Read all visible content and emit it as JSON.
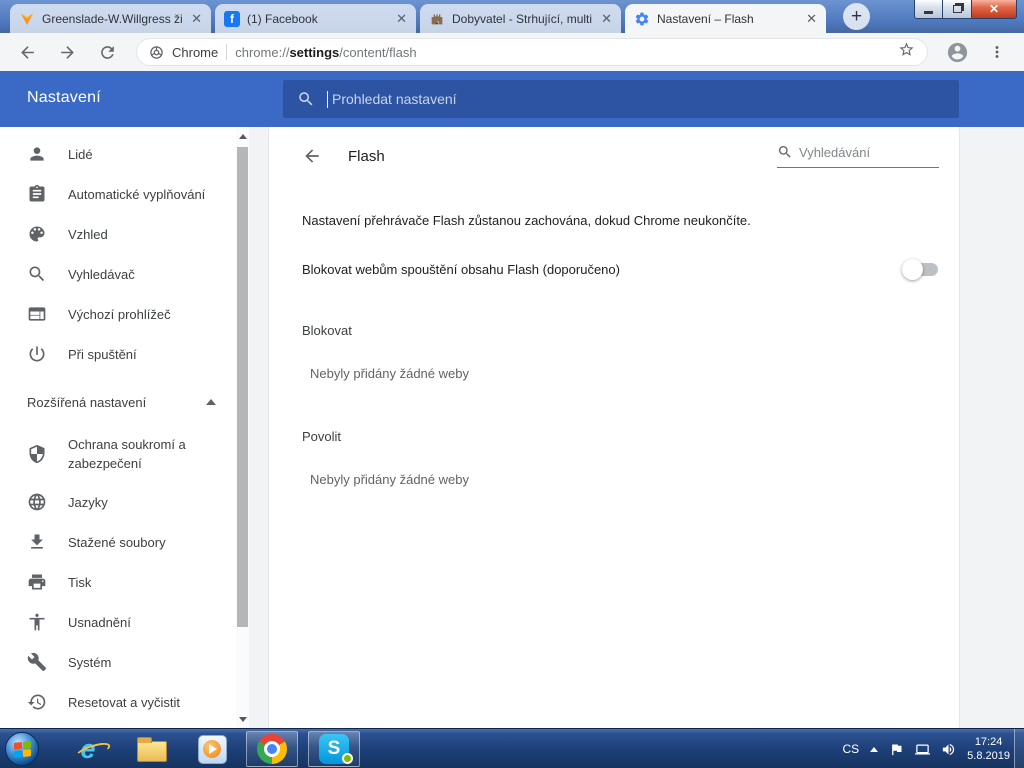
{
  "browser": {
    "tabs": [
      {
        "title": "Greenslade-W.Willgress ži",
        "icon": "v-logo",
        "active": false
      },
      {
        "title": "(1) Facebook",
        "icon": "facebook",
        "active": false
      },
      {
        "title": "Dobyvatel - Strhující, multi",
        "icon": "castle",
        "active": false
      },
      {
        "title": "Nastavení – Flash",
        "icon": "settings-gear",
        "active": true
      }
    ],
    "facebook_glyph": "f",
    "new_tab_glyph": "+",
    "close_glyph": "✕",
    "omnibox": {
      "badge": "Chrome",
      "scheme": "chrome://",
      "highlight": "settings",
      "path": "/content/flash"
    }
  },
  "settings_header": {
    "title": "Nastavení",
    "search_placeholder": "Prohledat nastavení"
  },
  "sidebar": {
    "items": [
      {
        "icon": "person",
        "label": "Lidé"
      },
      {
        "icon": "assignment",
        "label": "Automatické vyplňování"
      },
      {
        "icon": "palette",
        "label": "Vzhled"
      },
      {
        "icon": "search",
        "label": "Vyhledávač"
      },
      {
        "icon": "web",
        "label": "Výchozí prohlížeč"
      },
      {
        "icon": "power",
        "label": "Při spuštění"
      },
      {
        "icon": "security",
        "label": "Ochrana soukromí a zabezpečení"
      },
      {
        "icon": "language",
        "label": "Jazyky"
      },
      {
        "icon": "download",
        "label": "Stažené soubory"
      },
      {
        "icon": "print",
        "label": "Tisk"
      },
      {
        "icon": "accessibility",
        "label": "Usnadnění"
      },
      {
        "icon": "build",
        "label": "Systém"
      },
      {
        "icon": "history",
        "label": "Resetovat a vyčistit"
      }
    ],
    "advanced_label": "Rozšířená nastavení"
  },
  "content": {
    "title": "Flash",
    "search_placeholder": "Vyhledávání",
    "description": "Nastavení přehrávače Flash zůstanou zachována, dokud Chrome neukončíte.",
    "toggle_row": {
      "label": "Blokovat webům spouštění obsahu Flash (doporučeno)",
      "state": "off"
    },
    "sections": [
      {
        "title": "Blokovat",
        "empty_text": "Nebyly přidány žádné weby"
      },
      {
        "title": "Povolit",
        "empty_text": "Nebyly přidány žádné weby"
      }
    ]
  },
  "taskbar": {
    "apps": [
      "start",
      "internet-explorer",
      "file-explorer",
      "media-player",
      "chrome",
      "skype"
    ],
    "skype_glyph": "S",
    "language": "CS",
    "time": "17:24",
    "date": "5.8.2019"
  },
  "colors": {
    "header_blue": "#3b6ac6",
    "header_search_blue": "#2d54a3",
    "frame_blue": "#4d77bd",
    "taskbar_blue": "#1d3f77",
    "toggle_off": "#bdc1c6",
    "gear_favicon": "#4285f4",
    "facebook_blue": "#1877f2",
    "page_bg": "#f1f3f4"
  }
}
